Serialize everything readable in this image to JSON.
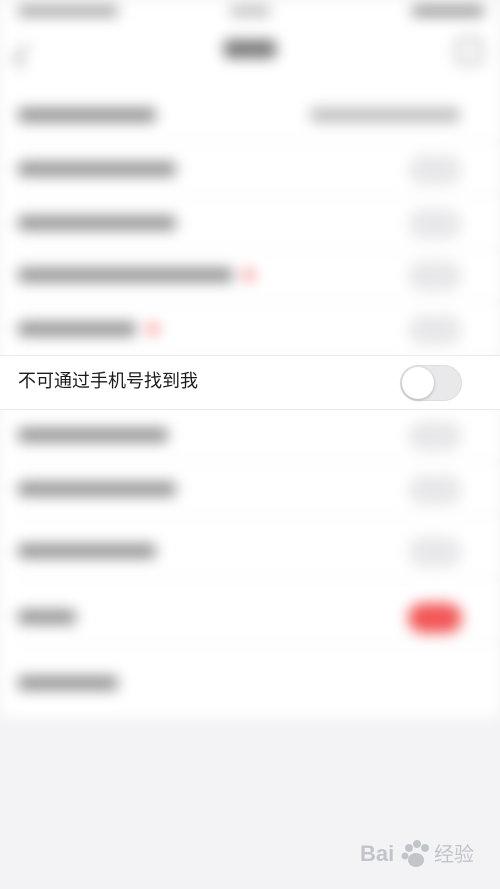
{
  "settings": {
    "focused_item": {
      "label": "不可通过手机号找到我",
      "toggle_on": false
    }
  },
  "colors": {
    "toggle_off_track": "#e9e9eb",
    "toggle_knob": "#ffffff",
    "accent_red": "#f25757",
    "page_background": "#f3f3f5"
  },
  "watermark": {
    "text": "Bai 经验",
    "brand_icon": "baidu-paw-icon"
  }
}
